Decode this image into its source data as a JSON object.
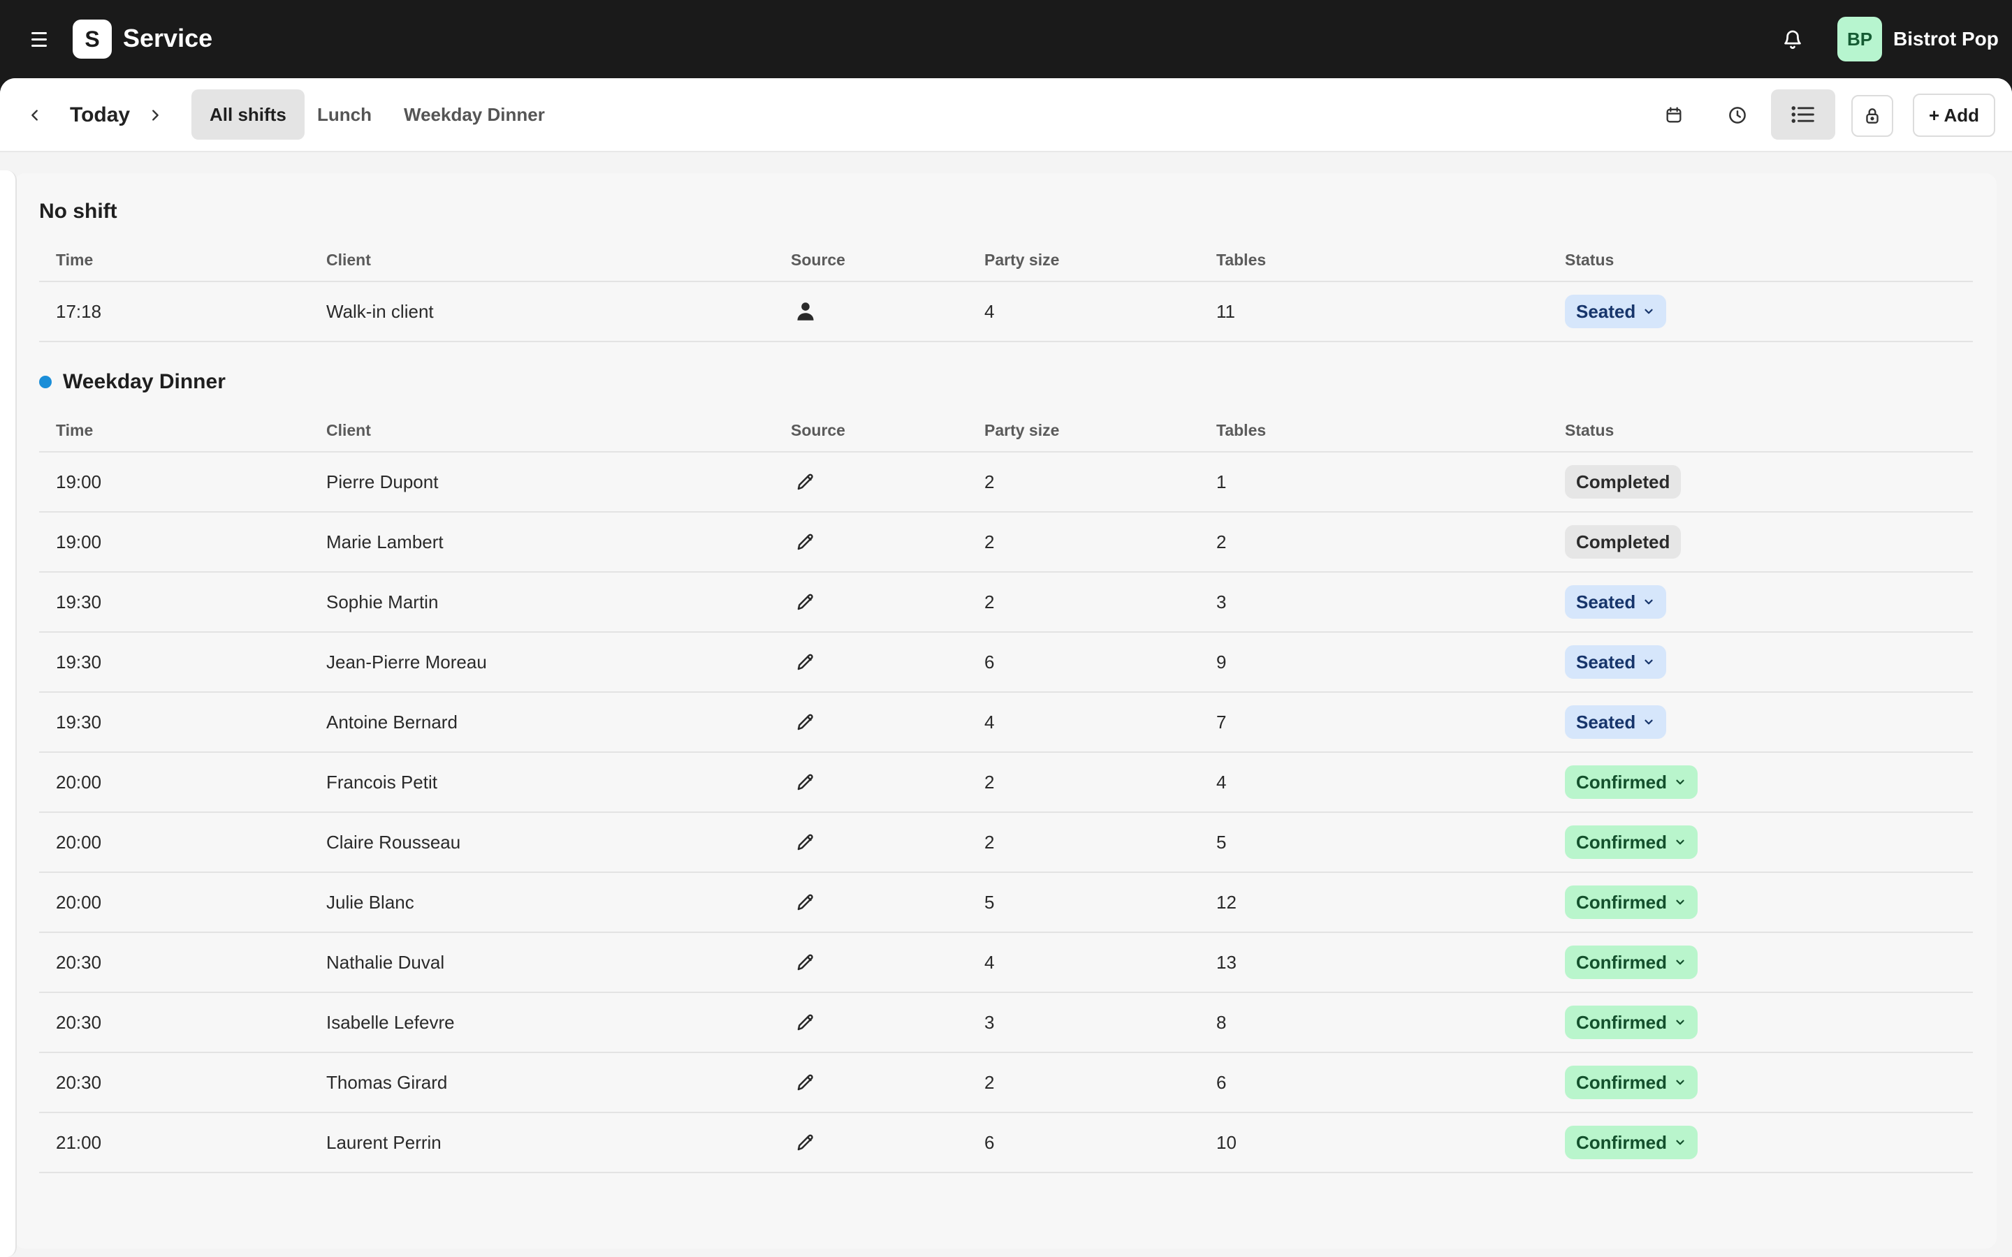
{
  "app": {
    "title": "Service",
    "logo_letter": "S",
    "user_initials": "BP",
    "venue_name": "Bistrot Pop",
    "accent_color": "#1b8ed8"
  },
  "toolbar": {
    "date_label": "Today",
    "tabs": [
      {
        "label": "All shifts",
        "active": true
      },
      {
        "label": "Lunch",
        "active": false
      },
      {
        "label": "Weekday Dinner",
        "active": false
      }
    ],
    "icons": [
      "calendar-icon",
      "clock-icon",
      "list-icon",
      "lock-icon"
    ],
    "add_label": "+ Add"
  },
  "columns": {
    "time": "Time",
    "client": "Client",
    "source": "Source",
    "party": "Party size",
    "tables": "Tables",
    "status": "Status"
  },
  "sections": [
    {
      "title": "No shift",
      "rows": [
        {
          "time": "17:18",
          "client": "Walk-in client",
          "source": "person-icon",
          "party": "4",
          "tables": "11",
          "status": "Seated"
        }
      ]
    },
    {
      "title": "Weekday Dinner",
      "rows": [
        {
          "time": "19:00",
          "client": "Pierre Dupont",
          "source": "pencil-icon",
          "party": "2",
          "tables": "1",
          "status": "Completed"
        },
        {
          "time": "19:00",
          "client": "Marie Lambert",
          "source": "pencil-icon",
          "party": "2",
          "tables": "2",
          "status": "Completed"
        },
        {
          "time": "19:30",
          "client": "Sophie Martin",
          "source": "pencil-icon",
          "party": "2",
          "tables": "3",
          "status": "Seated"
        },
        {
          "time": "19:30",
          "client": "Jean-Pierre Moreau",
          "source": "pencil-icon",
          "party": "6",
          "tables": "9",
          "status": "Seated"
        },
        {
          "time": "19:30",
          "client": "Antoine Bernard",
          "source": "pencil-icon",
          "party": "4",
          "tables": "7",
          "status": "Seated"
        },
        {
          "time": "20:00",
          "client": "Francois Petit",
          "source": "pencil-icon",
          "party": "2",
          "tables": "4",
          "status": "Confirmed"
        },
        {
          "time": "20:00",
          "client": "Claire Rousseau",
          "source": "pencil-icon",
          "party": "2",
          "tables": "5",
          "status": "Confirmed"
        },
        {
          "time": "20:00",
          "client": "Julie Blanc",
          "source": "pencil-icon",
          "party": "5",
          "tables": "12",
          "status": "Confirmed"
        },
        {
          "time": "20:30",
          "client": "Nathalie Duval",
          "source": "pencil-icon",
          "party": "4",
          "tables": "13",
          "status": "Confirmed"
        },
        {
          "time": "20:30",
          "client": "Isabelle Lefevre",
          "source": "pencil-icon",
          "party": "3",
          "tables": "8",
          "status": "Confirmed"
        },
        {
          "time": "20:30",
          "client": "Thomas Girard",
          "source": "pencil-icon",
          "party": "2",
          "tables": "6",
          "status": "Confirmed"
        },
        {
          "time": "21:00",
          "client": "Laurent Perrin",
          "source": "pencil-icon",
          "party": "6",
          "tables": "10",
          "status": "Confirmed"
        }
      ]
    }
  ]
}
